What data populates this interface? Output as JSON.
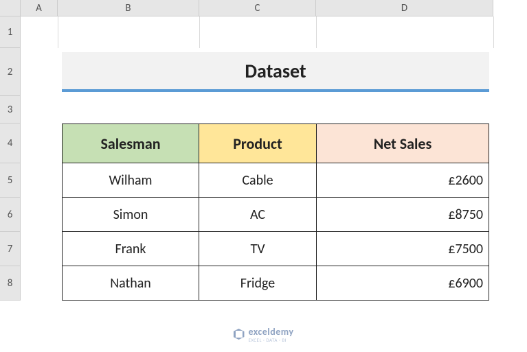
{
  "columns": [
    "A",
    "B",
    "C",
    "D"
  ],
  "rows": [
    "1",
    "2",
    "3",
    "4",
    "5",
    "6",
    "7",
    "8"
  ],
  "title": "Dataset",
  "headers": {
    "salesman": "Salesman",
    "product": "Product",
    "netsales": "Net Sales"
  },
  "data_rows": [
    {
      "salesman": "Wilham",
      "product": "Cable",
      "netsales": "£2600"
    },
    {
      "salesman": "Simon",
      "product": "AC",
      "netsales": "£8750"
    },
    {
      "salesman": "Frank",
      "product": "TV",
      "netsales": "£7500"
    },
    {
      "salesman": "Nathan",
      "product": "Fridge",
      "netsales": "£6900"
    }
  ],
  "watermark": {
    "brand": "exceldemy",
    "sub": "EXCEL · DATA · BI"
  },
  "colors": {
    "salesman_header": "#c6e0b4",
    "product_header": "#ffe699",
    "netsales_header": "#fce4d6",
    "title_underline": "#5b9bd5",
    "title_bg": "#f2f2f2"
  },
  "chart_data": {
    "type": "table",
    "title": "Dataset",
    "columns": [
      "Salesman",
      "Product",
      "Net Sales"
    ],
    "rows": [
      [
        "Wilham",
        "Cable",
        "£2600"
      ],
      [
        "Simon",
        "AC",
        "£8750"
      ],
      [
        "Frank",
        "TV",
        "£7500"
      ],
      [
        "Nathan",
        "Fridge",
        "£6900"
      ]
    ]
  }
}
